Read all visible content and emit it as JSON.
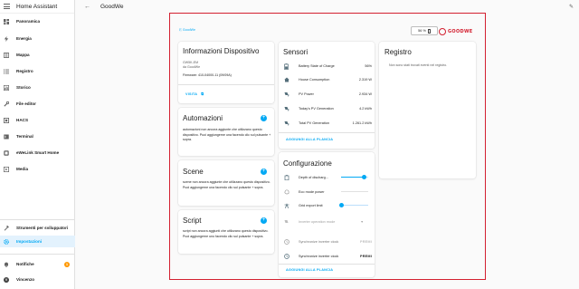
{
  "app_title": "Home Assistant",
  "page_title": "GoodWe",
  "sidebar": {
    "items": [
      {
        "label": "Panoramica"
      },
      {
        "label": "Energia"
      },
      {
        "label": "Mappa"
      },
      {
        "label": "Registro"
      },
      {
        "label": "Storico"
      },
      {
        "label": "File editor"
      },
      {
        "label": "HACS"
      },
      {
        "label": "Terminal"
      },
      {
        "label": "eWeLink Smart Home"
      },
      {
        "label": "Media"
      }
    ],
    "dev_tools": "Strumenti per sviluppatori",
    "settings": "Impostazioni",
    "notifications": "Notifiche",
    "notification_count": "1",
    "user": "Vincenzo",
    "user_initial": "V"
  },
  "device": {
    "brand_link": "⎘ GoodWe",
    "battery_chip": "56 %",
    "logo_text": "GOODWE",
    "info": {
      "title": "Informazioni Dispositivo",
      "model": "GW5K-EM",
      "manufacturer": "da GoodWe",
      "firmware": "Firmware: 410-04000-11 (09/09A)",
      "visit": "VISITA"
    },
    "automations": {
      "title": "Automazioni",
      "text": "automazioni non ancora aggiunte che utilizzano questo dispositivo. Puoi aggiungerne una facendo clic sul pulsante + sopra."
    },
    "scenes": {
      "title": "Scene",
      "text": "scene non ancora aggiunte che utilizzano questo dispositivo. Puoi aggiungerne una facendo clic sul pulsante + sopra."
    },
    "scripts": {
      "title": "Script",
      "text": "script non ancora aggiunti che utilizzano questo dispositivo. Puoi aggiungerne uno facendo clic sul pulsante + sopra."
    },
    "sensors": {
      "title": "Sensori",
      "rows": [
        {
          "label": "Battery State of Charge",
          "value": "56%"
        },
        {
          "label": "House Consumption",
          "value": "2.319 W"
        },
        {
          "label": "PV Power",
          "value": "2.934 W"
        },
        {
          "label": "Today's PV Generation",
          "value": "4.2 kWh"
        },
        {
          "label": "Total PV Generation",
          "value": "1.261.2 kWh"
        }
      ],
      "add_link": "AGGIUNGI ALLA PLANCIA"
    },
    "config": {
      "title": "Configurazione",
      "rows": [
        {
          "label": "Depth of discharg..."
        },
        {
          "label": "Eco mode power"
        },
        {
          "label": "Grid export limit"
        },
        {
          "label": "Inverter operation mode"
        },
        {
          "label": "Synchronize inverter clock",
          "action": "PREMI"
        },
        {
          "label": "Synchronize inverter clock",
          "action": "PREMI"
        }
      ],
      "sliders": [
        0.85,
        0.0,
        0.0
      ],
      "add_link": "AGGIUNGI ALLA PLANCIA"
    },
    "log": {
      "title": "Registro",
      "empty": "Non sono stati trovati eventi nel registro."
    }
  }
}
